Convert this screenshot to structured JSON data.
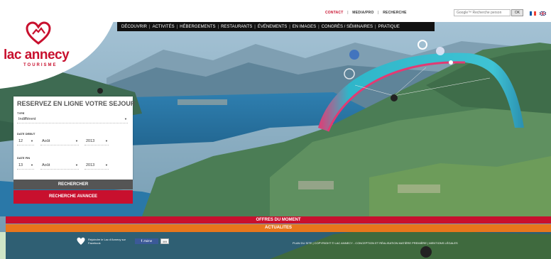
{
  "header": {
    "links": [
      "CONTACT",
      "MEDIA/PRO",
      "RECHERCHE"
    ],
    "search_placeholder": "Google™ Recherche person",
    "search_button": "OK"
  },
  "nav": {
    "items": [
      "DÉCOUVRIR",
      "ACTIVITÉS",
      "HÉBERGEMENTS",
      "RESTAURANTS",
      "ÉVÉNEMENTS",
      "EN IMAGES",
      "CONGRÈS / SÉMINAIRES",
      "PRATIQUE"
    ]
  },
  "logo": {
    "name": "lac annecy",
    "sub": "TOURISME"
  },
  "booking": {
    "title": "RESERVEZ EN LIGNE VOTRE SEJOUR",
    "type_label": "TYPE",
    "type_value": "Indifférent",
    "start_label": "DATE DEBUT",
    "start_day": "12",
    "start_month": "Août",
    "start_year": "2013",
    "end_label": "DATE FIN",
    "end_day": "13",
    "end_month": "Août",
    "end_year": "2013",
    "search_button": "RECHERCHER",
    "advanced_button": "RECHERCHE AVANCEE"
  },
  "bars": {
    "offers": "OFFRES DU MOMENT",
    "news": "ACTUALITES"
  },
  "footer": {
    "facebook_text": "Rejoindre le Lac d'Annecy sur Facebook",
    "like_label": "J'aime",
    "like_count": "305",
    "links": "PLAN DU SITE | COPYRIGHT © LAC ANNECY - CONCEPTION ET RÉALISATION MATIÈRE PREMIÈRE | MENTIONS LÉGALES"
  },
  "colors": {
    "brand_red": "#c8102e",
    "orange": "#e8761c",
    "nav_black": "#111111"
  }
}
